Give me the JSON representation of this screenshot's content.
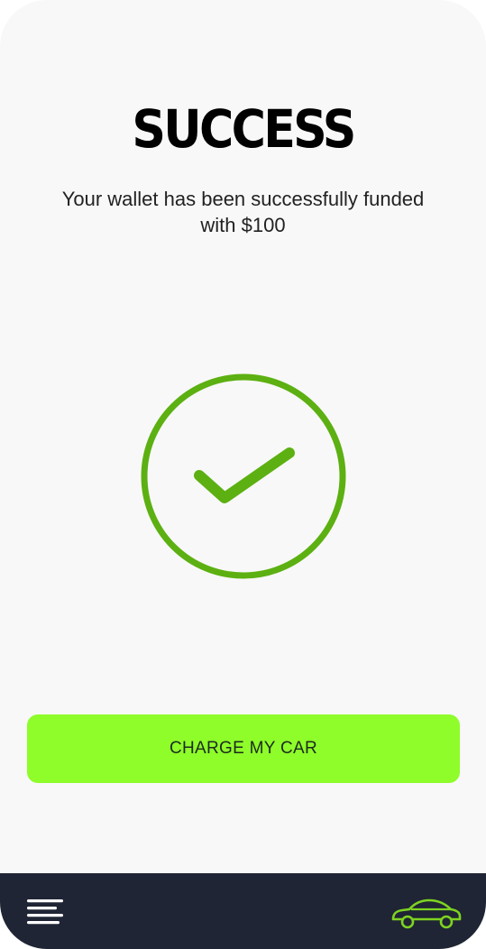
{
  "screen": {
    "title": "SUCCESS",
    "message": "Your wallet has been successfully funded with $100"
  },
  "status_icon": "check-circle-icon",
  "primary_action": {
    "label": "CHARGE MY CAR"
  },
  "bottom_nav": {
    "menu_icon": "menu-icon",
    "car_icon": "car-icon"
  },
  "colors": {
    "background": "#f8f8f8",
    "success_green": "#5cb011",
    "button_green": "#8efd2a",
    "nav_bar": "#1f2534",
    "car_icon_green": "#7ed321"
  }
}
